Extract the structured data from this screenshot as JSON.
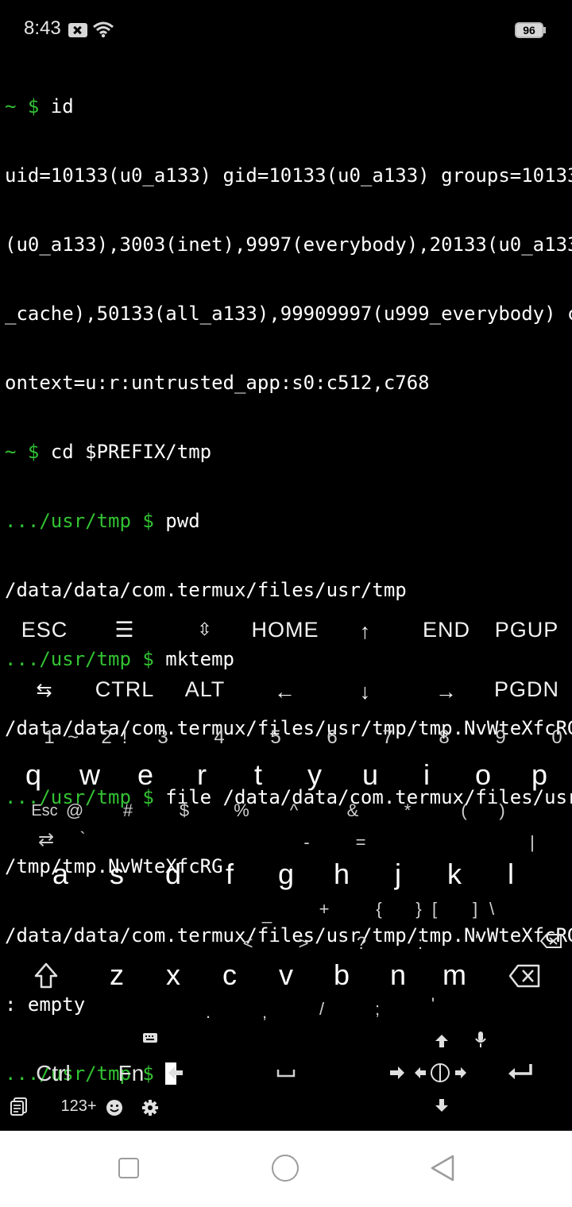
{
  "status_bar": {
    "time": "8:43",
    "battery": "96",
    "icons": [
      "notification-x-icon",
      "wifi-icon",
      "battery-icon"
    ]
  },
  "terminal": {
    "lines": [
      {
        "prompt": "~ $ ",
        "text": "id"
      },
      {
        "prompt": "",
        "text": "uid=10133(u0_a133) gid=10133(u0_a133) groups=10133"
      },
      {
        "prompt": "",
        "text": "(u0_a133),3003(inet),9997(everybody),20133(u0_a133"
      },
      {
        "prompt": "",
        "text": "_cache),50133(all_a133),99909997(u999_everybody) c"
      },
      {
        "prompt": "",
        "text": "ontext=u:r:untrusted_app:s0:c512,c768"
      },
      {
        "prompt": "~ $ ",
        "text": "cd $PREFIX/tmp"
      },
      {
        "prompt": ".../usr/tmp $ ",
        "text": "pwd"
      },
      {
        "prompt": "",
        "text": "/data/data/com.termux/files/usr/tmp"
      },
      {
        "prompt": ".../usr/tmp $ ",
        "text": "mktemp"
      },
      {
        "prompt": "",
        "text": "/data/data/com.termux/files/usr/tmp/tmp.NvWteXfcRG"
      },
      {
        "prompt": ".../usr/tmp $ ",
        "text": "file /data/data/com.termux/files/usr"
      },
      {
        "prompt": "",
        "text": "/tmp/tmp.NvWteXfcRG"
      },
      {
        "prompt": "",
        "text": "/data/data/com.termux/files/usr/tmp/tmp.NvWteXfcRG"
      },
      {
        "prompt": "",
        "text": ": empty"
      },
      {
        "prompt": ".../usr/tmp $ ",
        "text": ""
      }
    ],
    "prompt_color": "#32c232"
  },
  "extra_keys": {
    "row1": [
      "ESC",
      "☰",
      "⇳",
      "HOME",
      "↑",
      "END",
      "PGUP"
    ],
    "row2": [
      "⇆",
      "CTRL",
      "ALT",
      "←",
      "↓",
      "→",
      "PGDN"
    ]
  },
  "keyboard": {
    "numbers": [
      "1",
      "~",
      "2",
      "!",
      "3",
      "4",
      "5",
      "6",
      "7",
      "8",
      "9",
      "0"
    ],
    "row_q": [
      "q",
      "w",
      "e",
      "r",
      "t",
      "y",
      "u",
      "i",
      "o",
      "p"
    ],
    "row_q_syms": [
      "Esc",
      "@",
      "#",
      "$",
      "%",
      "^",
      "&",
      "*",
      "(",
      ")"
    ],
    "row_a_top_syms": [
      "⇄",
      "`",
      "-",
      "=",
      "|"
    ],
    "row_a": [
      "a",
      "s",
      "d",
      "f",
      "g",
      "h",
      "j",
      "k",
      "l"
    ],
    "row_a_syms": [
      "_",
      "+",
      "{",
      "}",
      "[",
      "]",
      "\\"
    ],
    "row_z_top_syms": [
      "<",
      ">",
      "?",
      ":",
      "\""
    ],
    "row_z": [
      "z",
      "x",
      "c",
      "v",
      "b",
      "n",
      "m"
    ],
    "row_z_syms": [
      ".",
      ",",
      "/",
      ";",
      "'"
    ],
    "bottom": {
      "ctrl": "Ctrl",
      "fn": "Fn",
      "num_mode": "123+"
    }
  }
}
